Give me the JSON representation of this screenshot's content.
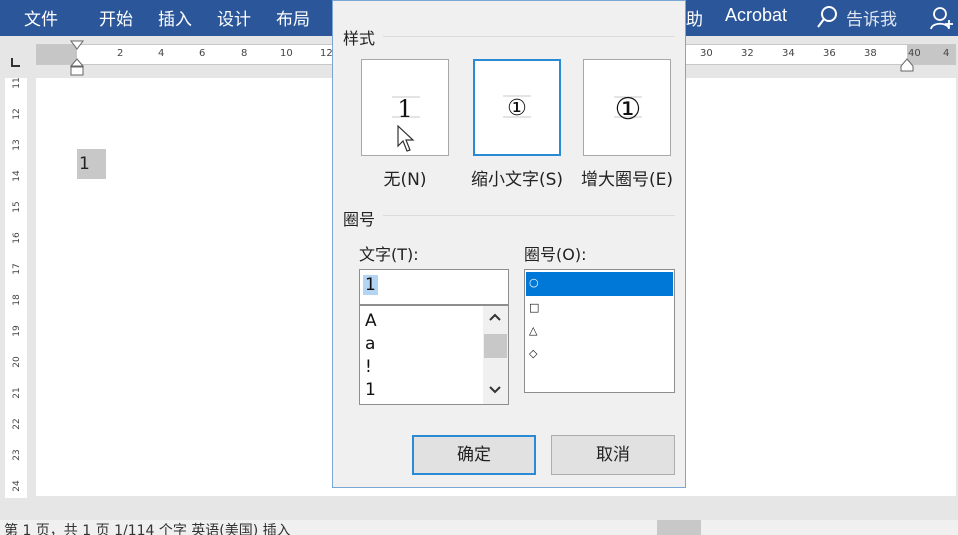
{
  "ribbon": {
    "tabs": [
      "文件",
      "开始",
      "插入",
      "设计",
      "布局"
    ],
    "right_tabs": [
      "助",
      "Acrobat"
    ],
    "tell_me": "告诉我"
  },
  "ruler": {
    "ticks": [
      "2",
      "4",
      "6",
      "8",
      "10",
      "12",
      "30",
      "32",
      "34",
      "36",
      "38",
      "40",
      "4"
    ],
    "vticks": [
      "11",
      "12",
      "13",
      "14",
      "15",
      "16",
      "17",
      "18",
      "19",
      "20",
      "21",
      "22",
      "23",
      "24"
    ]
  },
  "document": {
    "selected_text": "1"
  },
  "statusbar": {
    "text": "第 1 页，共 1 页    1/114 个字    英语(美国)    插入"
  },
  "dialog": {
    "style_group": "样式",
    "styles": [
      {
        "label": "无(N)",
        "glyph": "1"
      },
      {
        "label": "缩小文字(S)",
        "glyph": "①"
      },
      {
        "label": "增大圈号(E)",
        "glyph": "①"
      }
    ],
    "enclosure_group": "圈号",
    "text_label": "文字(T):",
    "text_value": "1",
    "text_list": [
      "A",
      "a",
      "!",
      "1"
    ],
    "enclosure_label": "圈号(O):",
    "enclosure_list": [
      "○",
      "□",
      "△",
      "◇"
    ],
    "ok": "确定",
    "cancel": "取消"
  },
  "colors": {
    "ribbon": "#2b579a",
    "accent": "#2a8ad4",
    "selection": "#0078d7"
  }
}
